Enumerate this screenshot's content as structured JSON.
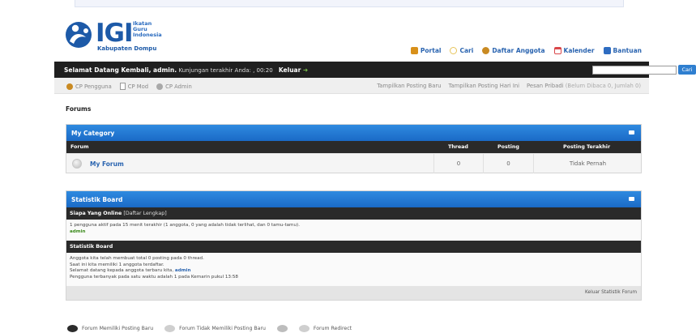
{
  "logo": {
    "mark": "IGI",
    "sub_lines": [
      "Ikatan",
      "Guru",
      "Indonesia"
    ],
    "place": "Kabupaten Dompu"
  },
  "topnav": [
    {
      "label": "Portal",
      "icon": "portal-icon",
      "color": "#d8901a"
    },
    {
      "label": "Cari",
      "icon": "search-icon",
      "color": "#e7c45a"
    },
    {
      "label": "Daftar Anggota",
      "icon": "members-icon",
      "color": "#c98a22"
    },
    {
      "label": "Kalender",
      "icon": "calendar-icon",
      "color": "#d9474a"
    },
    {
      "label": "Bantuan",
      "icon": "help-icon",
      "color": "#2e6cc1"
    }
  ],
  "welcome": {
    "greeting": "Selamat Datang Kembali, admin.",
    "visit": "Kunjungan terakhir Anda: , 00:20",
    "logout": "Keluar",
    "arrow": "➜",
    "search_button": "Cari",
    "search_placeholder": ""
  },
  "cp_bar": {
    "left": [
      {
        "label": "CP Pengguna",
        "icon": "user-icon"
      },
      {
        "label": "CP Mod",
        "icon": "document-icon"
      },
      {
        "label": "CP Admin",
        "icon": "globe-icon"
      }
    ],
    "right": {
      "new_posts": "Tampilkan Posting Baru",
      "today_posts": "Tampilkan Posting Hari Ini",
      "pm": "Pesan Pribadi",
      "pm_status": "(Belum Dibaca 0, Jumlah 0)"
    }
  },
  "page_title": "Forums",
  "category": {
    "title": "My Category",
    "columns": {
      "forum": "Forum",
      "thread": "Thread",
      "posting": "Posting",
      "last": "Posting Terakhir"
    },
    "forums": [
      {
        "name": "My Forum",
        "thread": "0",
        "posting": "0",
        "last": "Tidak Pernah"
      }
    ]
  },
  "stats": {
    "title": "Statistik Board",
    "online": {
      "header": "Siapa Yang Online",
      "header_link": "[Daftar Lengkap]",
      "line": "1 pengguna aktif pada 15 menit terakhir (1 anggota, 0 yang adalah tidak terlihat, dan 0 tamu-tamu).",
      "users": "admin"
    },
    "board": {
      "header": "Statistik Board",
      "line1": "Anggota kita telah membuat total 0 posting pada 0 thread.",
      "line2": "Saat ini kita memiliki 1 anggota terdaftar.",
      "line3_prefix": "Selamat datang kepada anggota terbaru kita,",
      "line3_user": "admin",
      "line4": "Pengguna terbanyak pada satu waktu adalah 1 pada Kemarin pukul 13:58"
    },
    "footer_link": "Keluar Statistik Forum"
  },
  "legend": [
    {
      "label": "Forum Memiliki Posting Baru",
      "color": "#2b2b2b"
    },
    {
      "label": "Forum Tidak Memiliki Posting Baru",
      "color": "#cfcfcf"
    },
    {
      "label": "",
      "color": "#bdbdbd"
    },
    {
      "label": "Forum Redirect",
      "color": "#cfcfcf"
    }
  ]
}
